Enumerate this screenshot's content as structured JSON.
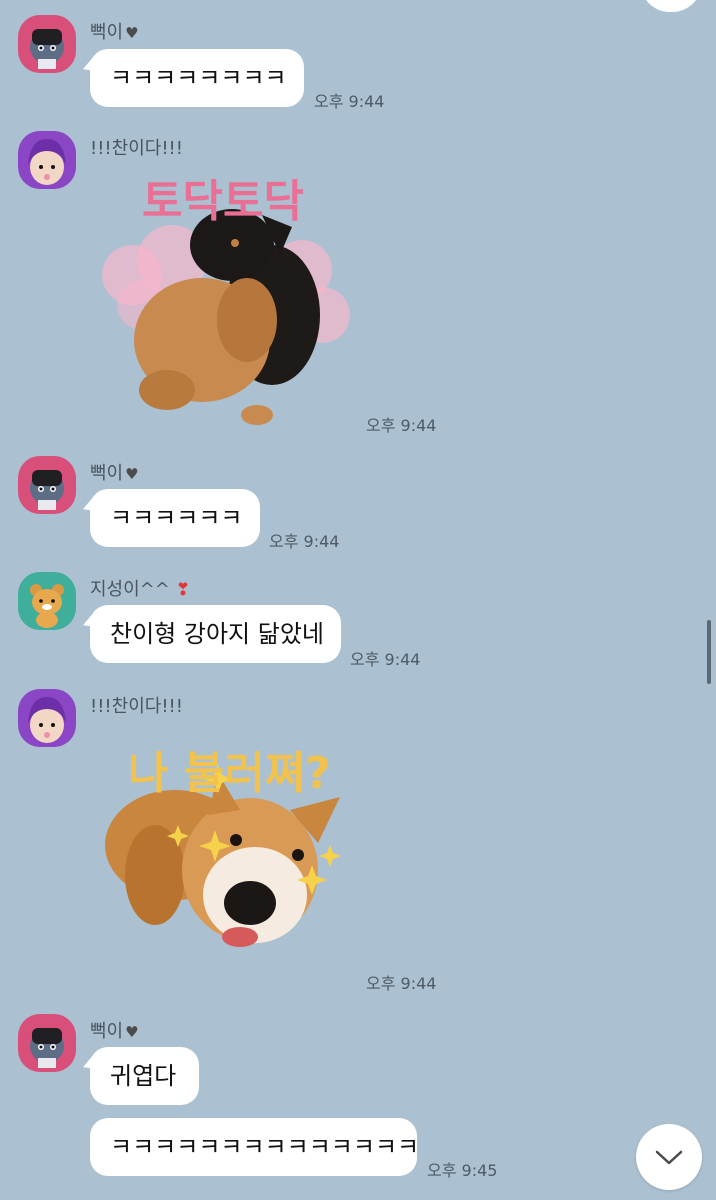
{
  "messages": [
    {
      "sender": "뻑이",
      "text": "ㅋㅋㅋㅋㅋㅋㅋㅋ",
      "time": "오후 9:44"
    },
    {
      "sender": "!!!찬이다!!!",
      "sticker_text": "토닥토닥",
      "time": "오후 9:44"
    },
    {
      "sender": "뻑이",
      "text": "ㅋㅋㅋㅋㅋㅋ",
      "time": "오후 9:44"
    },
    {
      "sender": "지성이^^",
      "text": "찬이형 강아지 닮았네",
      "time": "오후 9:44"
    },
    {
      "sender": "!!!찬이다!!!",
      "sticker_text": "나 불러쪄?",
      "time": "오후 9:44"
    },
    {
      "sender": "뻑이",
      "text": "귀엽다"
    },
    {
      "text": "ㅋㅋㅋㅋㅋㅋㅋㅋㅋㅋㅋㅋㅋㅋ",
      "time": "오후 9:45"
    }
  ],
  "symbols": {
    "dark_heart": "♥",
    "red_heart": "❣"
  },
  "colors": {
    "background": "#abc1d1",
    "bubble": "#ffffff",
    "sticker_pink": "#ea6f94",
    "sticker_yellow": "#f2c24e"
  }
}
